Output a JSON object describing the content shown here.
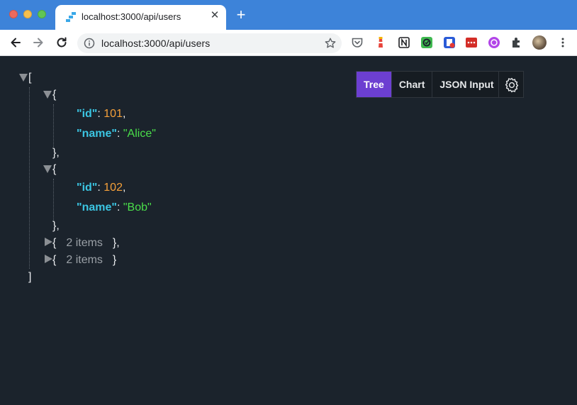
{
  "window": {
    "tab_title": "localhost:3000/api/users",
    "new_tab_label": "+",
    "close_label": "✕"
  },
  "toolbar": {
    "url": "localhost:3000/api/users"
  },
  "viewer": {
    "tabs": [
      {
        "label": "Tree",
        "active": true
      },
      {
        "label": "Chart",
        "active": false
      },
      {
        "label": "JSON Input",
        "active": false
      }
    ],
    "tree": {
      "root_open": "[",
      "root_close": "]",
      "items": [
        {
          "open": "{",
          "close": "},",
          "fields": [
            {
              "key": "\"id\"",
              "sep": ": ",
              "value": "101",
              "comma": ","
            },
            {
              "key": "\"name\"",
              "sep": ": ",
              "value": "\"Alice\"",
              "comma": ""
            }
          ]
        },
        {
          "open": "{",
          "close": "},",
          "fields": [
            {
              "key": "\"id\"",
              "sep": ": ",
              "value": "102",
              "comma": ","
            },
            {
              "key": "\"name\"",
              "sep": ": ",
              "value": "\"Bob\"",
              "comma": ""
            }
          ]
        },
        {
          "collapsed": true,
          "open": "{",
          "summary": "2 items",
          "close": "},"
        },
        {
          "collapsed": true,
          "open": "{",
          "summary": "2 items",
          "close": "}"
        }
      ]
    }
  },
  "colors": {
    "background": "#1b232c",
    "key": "#3bc5e2",
    "number": "#f5a03a",
    "string": "#4ade4a",
    "active_tab": "#6c3fd1"
  }
}
